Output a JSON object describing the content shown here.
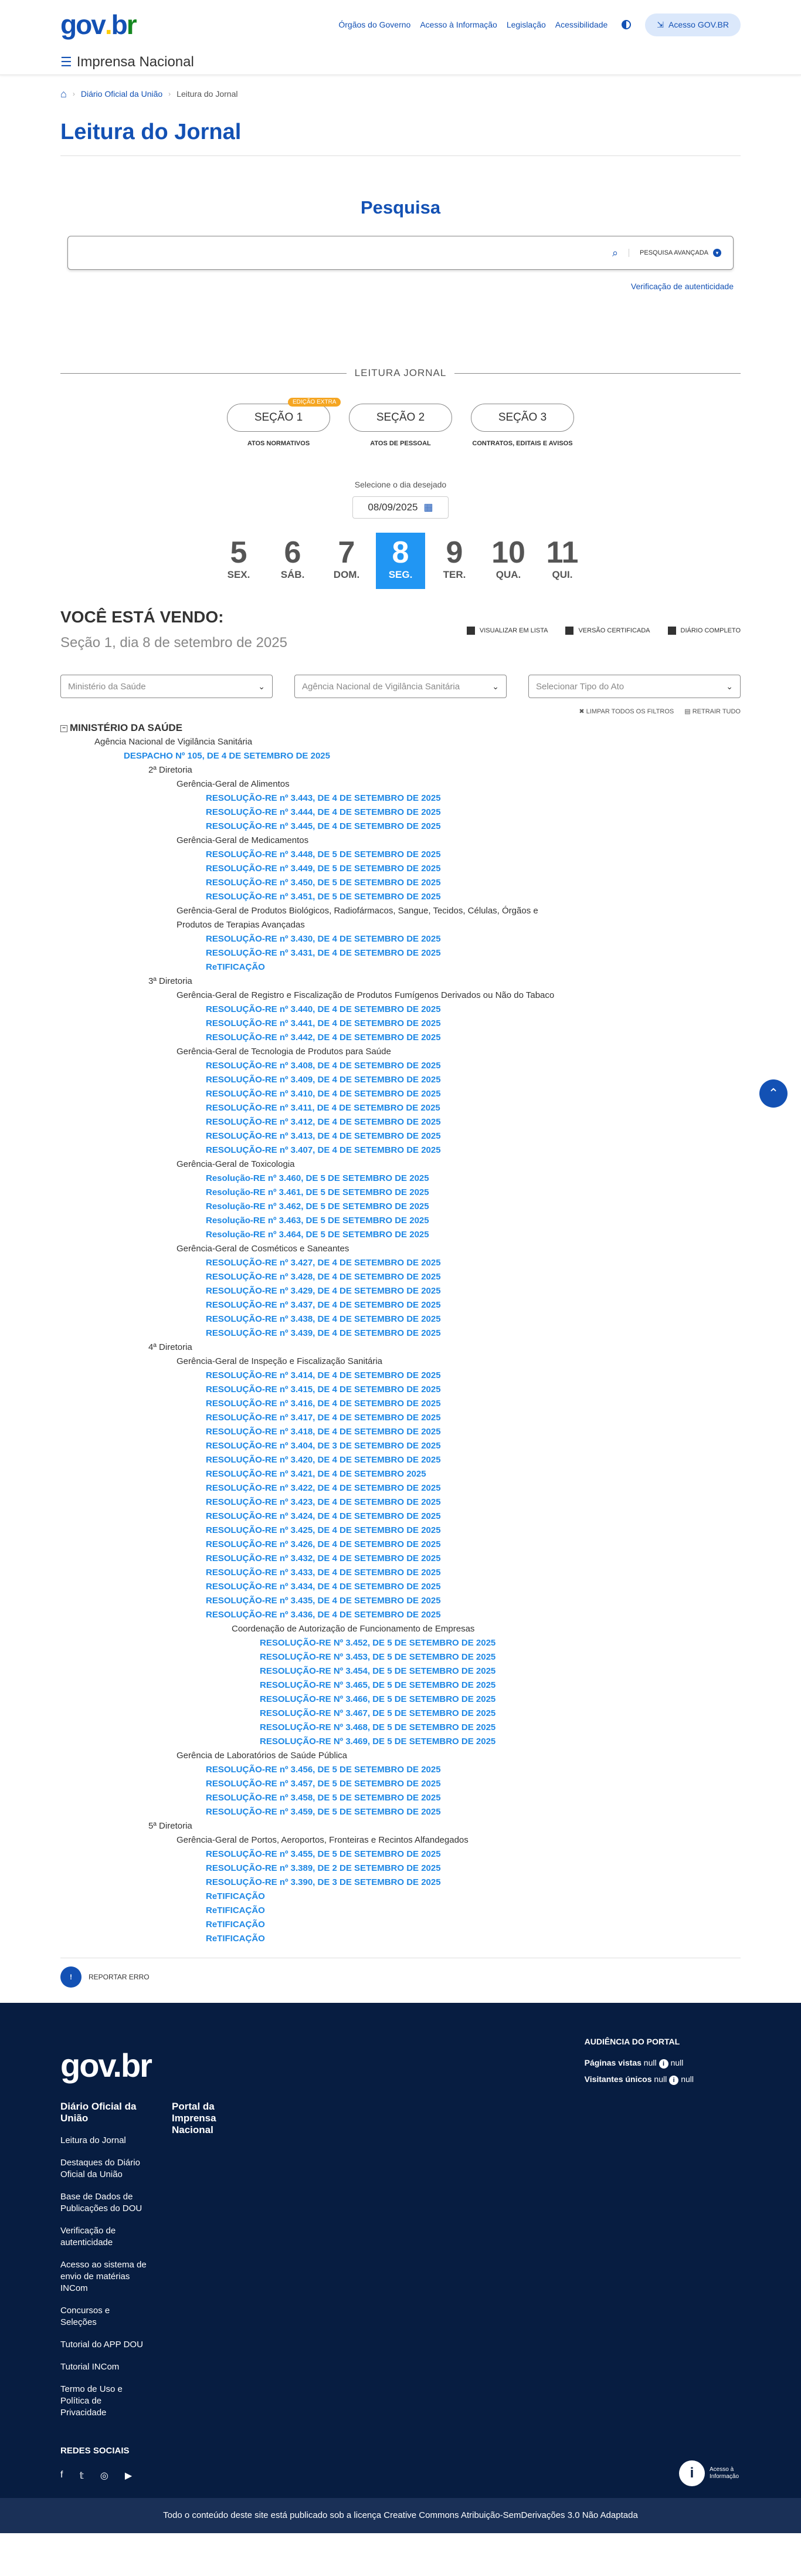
{
  "header": {
    "top_links": [
      "Órgãos do Governo",
      "Acesso à Informação",
      "Legislação",
      "Acessibilidade"
    ],
    "login_label": "Acesso GOV.BR",
    "site_name": "Imprensa Nacional"
  },
  "breadcrumb": {
    "items": [
      "Diário Oficial da União",
      "Leitura do Jornal"
    ]
  },
  "page_title": "Leitura do Jornal",
  "search": {
    "title": "Pesquisa",
    "advanced": "PESQUISA AVANÇADA",
    "verify": "Verificação de autenticidade"
  },
  "journal": {
    "label": "LEITURA JORNAL",
    "extra_badge": "EDIÇÃO EXTRA",
    "sections": [
      {
        "label": "SEÇÃO 1",
        "sub": "ATOS NORMATIVOS"
      },
      {
        "label": "SEÇÃO 2",
        "sub": "ATOS DE PESSOAL"
      },
      {
        "label": "SEÇÃO 3",
        "sub": "CONTRATOS, EDITAIS E AVISOS"
      }
    ],
    "select_day": "Selecione o dia desejado",
    "date": "08/09/2025",
    "days": [
      {
        "n": "5",
        "w": "SEX."
      },
      {
        "n": "6",
        "w": "SÁB."
      },
      {
        "n": "7",
        "w": "DOM."
      },
      {
        "n": "8",
        "w": "SEG.",
        "active": true
      },
      {
        "n": "9",
        "w": "TER."
      },
      {
        "n": "10",
        "w": "QUA."
      },
      {
        "n": "11",
        "w": "QUI."
      }
    ]
  },
  "viewing": {
    "title": "VOCÊ ESTÁ VENDO:",
    "subtitle": "Seção 1, dia 8 de setembro de 2025",
    "actions": [
      "VISUALIZAR EM LISTA",
      "VERSÃO CERTIFICADA",
      "DIÁRIO COMPLETO"
    ]
  },
  "filters": {
    "items": [
      "Ministério da Saúde",
      "Agência Nacional de Vigilância Sanitária",
      "Selecionar Tipo do Ato"
    ],
    "clear": "LIMPAR TODOS OS FILTROS",
    "collapse": "RETRAIR TUDO"
  },
  "tree": [
    {
      "d": 0,
      "t": "MINISTÉRIO DA SAÚDE"
    },
    {
      "d": 1,
      "t": "Agência Nacional de Vigilância Sanitária"
    },
    {
      "d": 2,
      "t": "DESPACHO Nº 105, DE 4 DE SETEMBRO DE 2025",
      "link": true
    },
    {
      "d": 3,
      "t": "2ª Diretoria"
    },
    {
      "d": 4,
      "t": "Gerência-Geral de Alimentos"
    },
    {
      "d": 5,
      "t": "RESOLUÇÃO-RE nº 3.443, DE 4 DE SETEMBRO DE 2025",
      "link": true
    },
    {
      "d": 5,
      "t": "RESOLUÇÃO-RE nº 3.444, DE 4 DE SETEMBRO DE 2025",
      "link": true
    },
    {
      "d": 5,
      "t": "RESOLUÇÃO-RE nº 3.445, DE 4 DE SETEMBRO DE 2025",
      "link": true
    },
    {
      "d": 4,
      "t": "Gerência-Geral de Medicamentos"
    },
    {
      "d": 5,
      "t": "RESOLUÇÃO-RE nº 3.448, DE 5 DE SETEMBRO DE 2025",
      "link": true
    },
    {
      "d": 5,
      "t": "RESOLUÇÃO-RE nº 3.449, DE 5 DE SETEMBRO DE 2025",
      "link": true
    },
    {
      "d": 5,
      "t": "RESOLUÇÃO-RE nº 3.450, DE 5 DE SETEMBRO DE 2025",
      "link": true
    },
    {
      "d": 5,
      "t": "RESOLUÇÃO-RE nº 3.451, DE 5 DE SETEMBRO DE 2025",
      "link": true
    },
    {
      "d": 4,
      "t": "Gerência-Geral de Produtos Biológicos, Radiofármacos, Sangue, Tecidos, Células, Órgãos e Produtos de Terapias Avançadas",
      "wrap": true
    },
    {
      "d": 5,
      "t": "RESOLUÇÃO-RE nº 3.430, DE 4 DE SETEMBRO DE 2025",
      "link": true
    },
    {
      "d": 5,
      "t": "RESOLUÇÃO-RE nº 3.431, DE 4 DE SETEMBRO DE 2025",
      "link": true
    },
    {
      "d": 5,
      "t": "ReTIFICAÇÃO",
      "link": true
    },
    {
      "d": 3,
      "t": "3ª Diretoria"
    },
    {
      "d": 4,
      "t": "Gerência-Geral de Registro e Fiscalização de Produtos Fumígenos Derivados ou Não do Tabaco"
    },
    {
      "d": 5,
      "t": "RESOLUÇÃO-RE nº 3.440, DE 4 DE SETEMBRO DE 2025",
      "link": true
    },
    {
      "d": 5,
      "t": "RESOLUÇÃO-RE nº 3.441, DE 4 DE SETEMBRO DE 2025",
      "link": true
    },
    {
      "d": 5,
      "t": "RESOLUÇÃO-RE nº 3.442, DE 4 DE SETEMBRO DE 2025",
      "link": true
    },
    {
      "d": 4,
      "t": "Gerência-Geral de Tecnologia de Produtos para Saúde"
    },
    {
      "d": 5,
      "t": "RESOLUÇÃO-RE nº 3.408, DE 4 DE SETEMBRO DE 2025",
      "link": true
    },
    {
      "d": 5,
      "t": "RESOLUÇÃO-RE nº 3.409, DE 4 DE SETEMBRO DE 2025",
      "link": true
    },
    {
      "d": 5,
      "t": "RESOLUÇÃO-RE nº 3.410, DE 4 DE SETEMBRO DE 2025",
      "link": true
    },
    {
      "d": 5,
      "t": "RESOLUÇÃO-RE nº 3.411, DE 4 DE SETEMBRO DE 2025",
      "link": true
    },
    {
      "d": 5,
      "t": "RESOLUÇÃO-RE nº 3.412, DE 4 DE SETEMBRO DE 2025",
      "link": true
    },
    {
      "d": 5,
      "t": "RESOLUÇÃO-RE nº 3.413, DE 4 DE SETEMBRO DE 2025",
      "link": true
    },
    {
      "d": 5,
      "t": "RESOLUÇÃO-RE nº 3.407, DE 4 DE SETEMBRO DE 2025",
      "link": true
    },
    {
      "d": 4,
      "t": "Gerência-Geral de Toxicologia"
    },
    {
      "d": 5,
      "t": "Resolução-RE nº 3.460, DE 5 DE SETEMBRO DE 2025",
      "link": true
    },
    {
      "d": 5,
      "t": "Resolução-RE nº 3.461, DE 5 DE SETEMBRO DE 2025",
      "link": true
    },
    {
      "d": 5,
      "t": "Resolução-RE nº 3.462, DE 5 DE SETEMBRO DE 2025",
      "link": true
    },
    {
      "d": 5,
      "t": "Resolução-RE nº 3.463, DE 5 DE SETEMBRO DE 2025",
      "link": true
    },
    {
      "d": 5,
      "t": "Resolução-RE nº 3.464, DE 5 DE SETEMBRO DE 2025",
      "link": true
    },
    {
      "d": 4,
      "t": "Gerência-Geral de Cosméticos e Saneantes"
    },
    {
      "d": 5,
      "t": "RESOLUÇÃO-RE nº 3.427, DE 4 DE SETEMBRO DE 2025",
      "link": true
    },
    {
      "d": 5,
      "t": "RESOLUÇÃO-RE nº 3.428, DE 4 DE SETEMBRO DE 2025",
      "link": true
    },
    {
      "d": 5,
      "t": "RESOLUÇÃO-RE nº 3.429, DE 4 DE SETEMBRO DE 2025",
      "link": true
    },
    {
      "d": 5,
      "t": "RESOLUÇÃO-RE nº 3.437, DE 4 DE SETEMBRO DE 2025",
      "link": true
    },
    {
      "d": 5,
      "t": "RESOLUÇÃO-RE nº 3.438, DE 4 DE SETEMBRO DE 2025",
      "link": true
    },
    {
      "d": 5,
      "t": "RESOLUÇÃO-RE nº 3.439, DE 4 DE SETEMBRO DE 2025",
      "link": true
    },
    {
      "d": 3,
      "t": "4ª Diretoria"
    },
    {
      "d": 4,
      "t": "Gerência-Geral de Inspeção e Fiscalização Sanitária"
    },
    {
      "d": 5,
      "t": "RESOLUÇÃO-RE nº 3.414, DE 4 DE SETEMBRO DE 2025",
      "link": true
    },
    {
      "d": 5,
      "t": "RESOLUÇÃO-RE nº 3.415, DE 4 DE SETEMBRO DE 2025",
      "link": true
    },
    {
      "d": 5,
      "t": "RESOLUÇÃO-RE nº 3.416, DE 4 DE SETEMBRO DE 2025",
      "link": true
    },
    {
      "d": 5,
      "t": "RESOLUÇÃO-RE nº 3.417, DE 4 DE SETEMBRO DE 2025",
      "link": true
    },
    {
      "d": 5,
      "t": "RESOLUÇÃO-RE nº 3.418, DE 4 DE SETEMBRO DE 2025",
      "link": true
    },
    {
      "d": 5,
      "t": "RESOLUÇÃO-RE nº 3.404, DE 3 DE SETEMBRO DE 2025",
      "link": true
    },
    {
      "d": 5,
      "t": "RESOLUÇÃO-RE nº 3.420, DE 4 DE SETEMBRO DE 2025",
      "link": true
    },
    {
      "d": 5,
      "t": "RESOLUÇÃO-RE nº 3.421, DE 4 DE SETEMBRO 2025",
      "link": true
    },
    {
      "d": 5,
      "t": "RESOLUÇÃO-RE nº 3.422, DE 4 DE SETEMBRO DE 2025",
      "link": true
    },
    {
      "d": 5,
      "t": "RESOLUÇÃO-RE nº 3.423, DE 4 DE SETEMBRO DE 2025",
      "link": true
    },
    {
      "d": 5,
      "t": "RESOLUÇÃO-RE nº 3.424, DE 4 DE SETEMBRO DE 2025",
      "link": true
    },
    {
      "d": 5,
      "t": "RESOLUÇÃO-RE nº 3.425, DE 4 DE SETEMBRO DE 2025",
      "link": true
    },
    {
      "d": 5,
      "t": "RESOLUÇÃO-RE nº 3.426, DE 4 DE SETEMBRO DE 2025",
      "link": true
    },
    {
      "d": 5,
      "t": "RESOLUÇÃO-RE nº 3.432, DE 4 DE SETEMBRO DE 2025",
      "link": true
    },
    {
      "d": 5,
      "t": "RESOLUÇÃO-RE nº 3.433, DE 4 DE SETEMBRO DE 2025",
      "link": true
    },
    {
      "d": 5,
      "t": "RESOLUÇÃO-RE nº 3.434, DE 4 DE SETEMBRO DE 2025",
      "link": true
    },
    {
      "d": 5,
      "t": "RESOLUÇÃO-RE nº 3.435, DE 4 DE SETEMBRO DE 2025",
      "link": true
    },
    {
      "d": 5,
      "t": "RESOLUÇÃO-RE nº 3.436, DE 4 DE SETEMBRO DE 2025",
      "link": true
    },
    {
      "d": 6,
      "t": "Coordenação de Autorização de Funcionamento de Empresas"
    },
    {
      "d": 7,
      "t": "RESOLUÇÃO-RE Nº 3.452, DE 5 DE SETEMBRO DE 2025",
      "link": true
    },
    {
      "d": 7,
      "t": "RESOLUÇÃO-RE Nº 3.453, DE 5 DE SETEMBRO DE 2025",
      "link": true
    },
    {
      "d": 7,
      "t": "RESOLUÇÃO-RE Nº 3.454, DE 5 DE SETEMBRO DE 2025",
      "link": true
    },
    {
      "d": 7,
      "t": "RESOLUÇÃO-RE Nº 3.465, DE 5 DE SETEMBRO DE 2025",
      "link": true
    },
    {
      "d": 7,
      "t": "RESOLUÇÃO-RE Nº 3.466, DE 5 DE SETEMBRO DE 2025",
      "link": true
    },
    {
      "d": 7,
      "t": "RESOLUÇÃO-RE Nº 3.467, DE 5 DE SETEMBRO DE 2025",
      "link": true
    },
    {
      "d": 7,
      "t": "RESOLUÇÃO-RE Nº 3.468, DE 5 DE SETEMBRO DE 2025",
      "link": true
    },
    {
      "d": 7,
      "t": "RESOLUÇÃO-RE Nº 3.469, DE 5 DE SETEMBRO DE 2025",
      "link": true
    },
    {
      "d": 4,
      "t": "Gerência de Laboratórios de Saúde Pública"
    },
    {
      "d": 5,
      "t": "RESOLUÇÃO-RE nº 3.456, DE 5 DE SETEMBRO DE 2025",
      "link": true
    },
    {
      "d": 5,
      "t": "RESOLUÇÃO-RE nº 3.457, DE 5 DE SETEMBRO DE 2025",
      "link": true
    },
    {
      "d": 5,
      "t": "RESOLUÇÃO-RE nº 3.458, DE 5 DE SETEMBRO DE 2025",
      "link": true
    },
    {
      "d": 5,
      "t": "RESOLUÇÃO-RE nº 3.459, DE 5 DE SETEMBRO DE 2025",
      "link": true
    },
    {
      "d": 3,
      "t": "5ª Diretoria"
    },
    {
      "d": 4,
      "t": "Gerência-Geral de Portos, Aeroportos, Fronteiras e Recintos Alfandegados"
    },
    {
      "d": 5,
      "t": "RESOLUÇÃO-RE nº 3.455, DE 5 DE SETEMBRO DE 2025",
      "link": true
    },
    {
      "d": 5,
      "t": "RESOLUÇÃO-RE nº 3.389, DE 2 DE SETEMBRO DE 2025",
      "link": true
    },
    {
      "d": 5,
      "t": "RESOLUÇÃO-RE nº 3.390, DE 3 DE SETEMBRO DE 2025",
      "link": true
    },
    {
      "d": 5,
      "t": "ReTIFICAÇÃO",
      "link": true
    },
    {
      "d": 5,
      "t": "ReTIFICAÇÃO",
      "link": true
    },
    {
      "d": 5,
      "t": "ReTIFICAÇÃO",
      "link": true
    },
    {
      "d": 5,
      "t": "ReTIFICAÇÃO",
      "link": true
    }
  ],
  "report": "REPORTAR ERRO",
  "footer": {
    "col1_title": "Diário Oficial da União",
    "col1_links": [
      "Leitura do Jornal",
      "Destaques do Diário Oficial da União",
      "Base de Dados de Publicações do DOU",
      "Verificação de autenticidade",
      "Acesso ao sistema de envio de matérias INCom",
      "Concursos e Seleções",
      "Tutorial do APP DOU",
      "Tutorial INCom",
      "Termo de Uso e Política de Privacidade"
    ],
    "col2_title": "Portal da Imprensa Nacional",
    "audience_title": "AUDIÊNCIA DO PORTAL",
    "views_label": "Páginas vistas",
    "unique_label": "Visitantes únicos",
    "views_value": "null",
    "views_value2": "null",
    "unique_value": "null",
    "unique_value2": "null",
    "social_title": "REDES SOCIAIS",
    "access_label": "Acesso à Informação",
    "license": "Todo o conteúdo deste site está publicado sob a licença Creative Commons Atribuição-SemDerivações 3.0 Não Adaptada"
  }
}
